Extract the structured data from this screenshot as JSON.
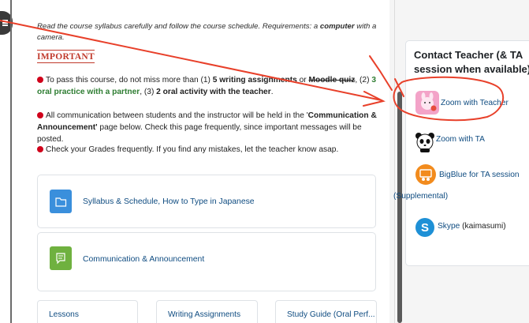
{
  "intro": {
    "text_before": "Read the course syllabus carefully and follow the course schedule.  Requirements: a ",
    "bold": "computer",
    "text_after": " with a camera."
  },
  "important_label": "IMPORTANT",
  "rules": {
    "r1": {
      "a": "To pass this course, do not miss more than (1) ",
      "b": "5 writing assignments",
      "c": " or ",
      "d": "Moodle quiz",
      "e": ", (2) ",
      "f": "3 oral practice with a partner",
      "g": ", (3) ",
      "h": "2 oral activity with the teacher",
      "i": "."
    },
    "r2": {
      "a": "All communication between students and the instructor will be held in the '",
      "b": "Communication & Announcement'",
      "c": " page below. Check this page frequently, since important messages will be posted."
    },
    "r3": "Check your Grades frequently. If you find any mistakes, let the teacher know asap."
  },
  "cards": {
    "syllabus": "Syllabus & Schedule, How to Type in Japanese",
    "communication": "Communication & Announcement"
  },
  "bottom_tiles": {
    "lessons": "Lessons",
    "writing": "Writing Assignments",
    "study": "Study Guide (Oral Perf..."
  },
  "contact_block": {
    "title": "Contact Teacher (& TA session when available)",
    "zoom_teacher": "Zoom with Teacher",
    "zoom_ta": "Zoom with TA",
    "bigblue": "BigBlue for TA session",
    "bigblue_suffix": "(Supplemental)",
    "skype": "Skype",
    "skype_id": " (kaimasumi)"
  },
  "colors": {
    "link": "#0f4c81",
    "annotation_red": "#e8402a",
    "green_text": "#2e7d32"
  }
}
